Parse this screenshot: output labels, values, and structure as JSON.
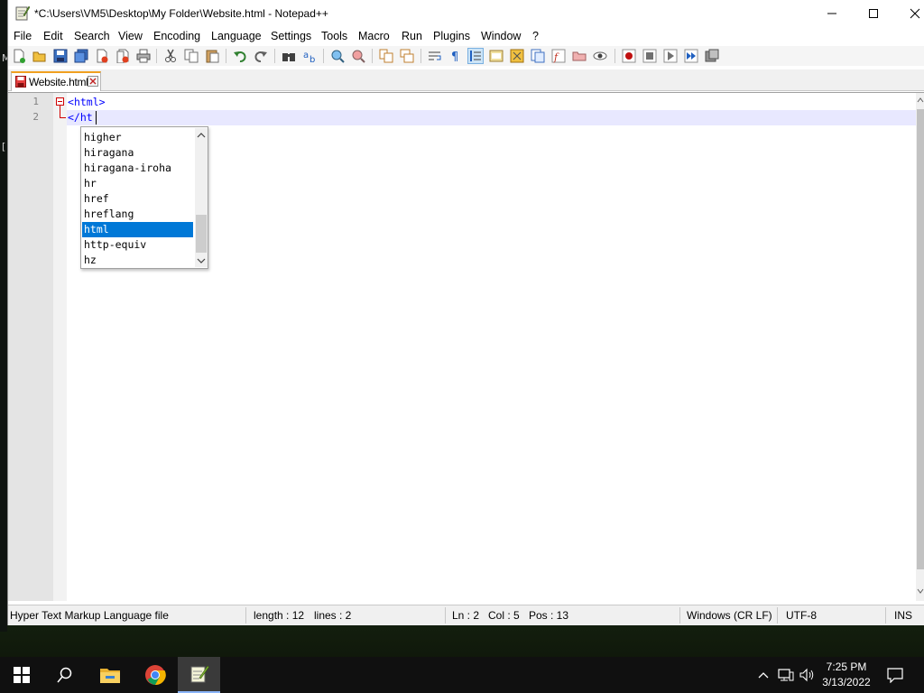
{
  "window": {
    "title": "*C:\\Users\\VM5\\Desktop\\My Folder\\Website.html - Notepad++"
  },
  "menu": [
    "File",
    "Edit",
    "Search",
    "View",
    "Encoding",
    "Language",
    "Settings",
    "Tools",
    "Macro",
    "Run",
    "Plugins",
    "Window",
    "?"
  ],
  "tabs": [
    {
      "label": "Website.html",
      "active": true
    }
  ],
  "editor": {
    "line_numbers": [
      "1",
      "2"
    ],
    "lines": [
      {
        "open": "<",
        "name": "html",
        "close": ">"
      },
      {
        "open": "</",
        "name": "ht",
        "close": ""
      }
    ]
  },
  "autocomplete": {
    "items": [
      "higher",
      "hiragana",
      "hiragana-iroha",
      "hr",
      "href",
      "hreflang",
      "html",
      "http-equiv",
      "hz"
    ],
    "selected_index": 6,
    "selection_color": "#0078d7"
  },
  "statusbar": {
    "file_type": "Hyper Text Markup Language file",
    "length": "length : 12",
    "lines": "lines : 2",
    "ln": "Ln : 2",
    "col": "Col : 5",
    "pos": "Pos : 13",
    "eol": "Windows (CR LF)",
    "encoding": "UTF-8",
    "mode": "INS"
  },
  "desktop": {
    "edge_chars": [
      "M",
      "["
    ]
  },
  "taskbar": {
    "icons": [
      "windows-start-icon",
      "search-icon",
      "file-explorer-icon",
      "chrome-icon",
      "notepadpp-icon"
    ],
    "tray_icons": [
      "chevron-up-icon",
      "network-icon",
      "volume-icon",
      "notification-icon"
    ],
    "time": "7:25 PM",
    "date": "3/13/2022"
  },
  "colors": {
    "tag_blue": "#0000ff",
    "fold_red": "#d00000",
    "tab_accent": "#f0a020",
    "current_line": "#e8e8ff"
  }
}
